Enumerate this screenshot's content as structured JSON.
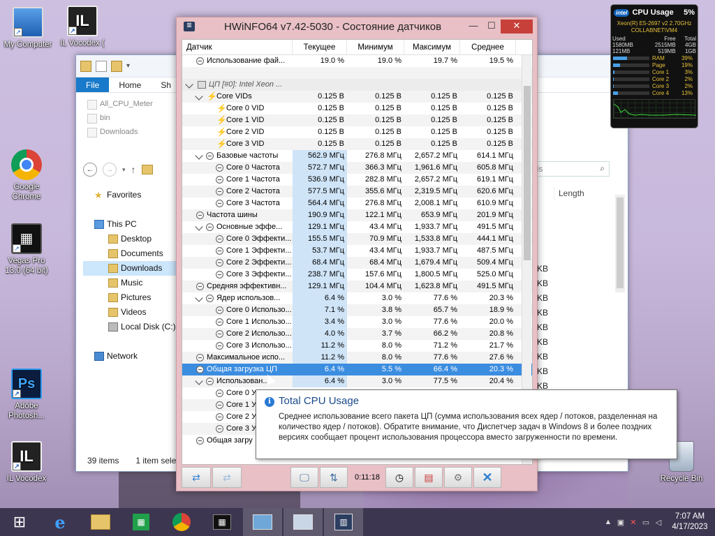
{
  "desktop": {
    "icons": [
      {
        "label": "My Computer",
        "icon": "computer-icon"
      },
      {
        "label": "IL Vocodex (",
        "icon": "il-vocodex-icon"
      },
      {
        "label": "Google Chrome",
        "icon": "chrome-icon"
      },
      {
        "label": "Vegas Pro 13.0 (64 bit)",
        "icon": "vegas-icon"
      },
      {
        "label": "Adobe Photosh...",
        "icon": "photoshop-icon"
      },
      {
        "label": "IL Vocodex",
        "icon": "il-vocodex-icon"
      },
      {
        "label": "Recycle Bin",
        "icon": "recycle-bin-icon"
      }
    ]
  },
  "explorer": {
    "ribbon": {
      "file": "File",
      "home": "Home",
      "share": "Sh"
    },
    "recent": [
      "All_CPU_Meter",
      "bin",
      "Downloads"
    ],
    "search_partial": "ads",
    "column_length": "Length",
    "nav": {
      "favorites": "Favorites",
      "this_pc": "This PC",
      "items": [
        "Desktop",
        "Documents",
        "Downloads",
        "Music",
        "Pictures",
        "Videos",
        "Local Disk (C:)"
      ],
      "network": "Network"
    },
    "kb_values": [
      "KB",
      "KB",
      "KB",
      "KB",
      "KB",
      "KB",
      "KB",
      "KB",
      "KB",
      "KB",
      "KB"
    ],
    "status_items": "39 items",
    "status_selected": "1 item selec"
  },
  "gadget": {
    "title": "CPU Usage",
    "percent": "5%",
    "cpu_line1": "Xeon(R) E5-2697 v2 2.70GHz",
    "cpu_line2": "COLLABNET\\VM4",
    "headers": [
      "Used",
      "Free",
      "Total"
    ],
    "row1": [
      "1580MB",
      "2515MB",
      "4GB"
    ],
    "row2": [
      "121MB",
      "519MB",
      "1GB"
    ],
    "meters": [
      {
        "label": "RAM",
        "value": "39%",
        "fill": 0.39
      },
      {
        "label": "Page",
        "value": "19%",
        "fill": 0.19
      },
      {
        "label": "Core 1",
        "value": "3%",
        "fill": 0.03
      },
      {
        "label": "Core 2",
        "value": "2%",
        "fill": 0.02
      },
      {
        "label": "Core 3",
        "value": "2%",
        "fill": 0.02
      },
      {
        "label": "Core 4",
        "value": "13%",
        "fill": 0.13
      }
    ]
  },
  "hwinfo": {
    "title": "HWiNFO64 v7.42-5030 - Состояние датчиков",
    "headers": {
      "sensor": "Датчик",
      "current": "Текущее",
      "min": "Минимум",
      "max": "Максимум",
      "avg": "Среднее"
    },
    "rows": [
      {
        "type": "circ",
        "indent": 0,
        "name": "Использование фай...",
        "cur": "19.0 %",
        "min": "19.0 %",
        "max": "19.7 %",
        "avg": "19.5 %"
      },
      {
        "type": "blank",
        "indent": 0,
        "name": "",
        "cur": "",
        "min": "",
        "max": "",
        "avg": ""
      },
      {
        "type": "grp",
        "indent": 0,
        "name": "ЦП [#0]: Intel Xeon ...",
        "cur": "",
        "min": "",
        "max": "",
        "avg": ""
      },
      {
        "type": "bolt",
        "indent": 1,
        "exp": true,
        "name": "Core VIDs",
        "cur": "0.125 В",
        "min": "0.125 В",
        "max": "0.125 В",
        "avg": "0.125 В"
      },
      {
        "type": "bolt",
        "indent": 2,
        "name": "Core 0 VID",
        "cur": "0.125 В",
        "min": "0.125 В",
        "max": "0.125 В",
        "avg": "0.125 В"
      },
      {
        "type": "bolt",
        "indent": 2,
        "name": "Core 1 VID",
        "cur": "0.125 В",
        "min": "0.125 В",
        "max": "0.125 В",
        "avg": "0.125 В"
      },
      {
        "type": "bolt",
        "indent": 2,
        "name": "Core 2 VID",
        "cur": "0.125 В",
        "min": "0.125 В",
        "max": "0.125 В",
        "avg": "0.125 В"
      },
      {
        "type": "bolt",
        "indent": 2,
        "name": "Core 3 VID",
        "cur": "0.125 В",
        "min": "0.125 В",
        "max": "0.125 В",
        "avg": "0.125 В"
      },
      {
        "type": "circ",
        "indent": 1,
        "exp": true,
        "hl": true,
        "name": "Базовые частоты",
        "cur": "562.9 МГц",
        "min": "276.8 МГц",
        "max": "2,657.2 МГц",
        "avg": "614.1 МГц"
      },
      {
        "type": "circ",
        "indent": 2,
        "hl": true,
        "name": "Core 0 Частота",
        "cur": "572.7 МГц",
        "min": "366.3 МГц",
        "max": "1,961.6 МГц",
        "avg": "605.8 МГц"
      },
      {
        "type": "circ",
        "indent": 2,
        "hl": true,
        "name": "Core 1 Частота",
        "cur": "536.9 МГц",
        "min": "282.8 МГц",
        "max": "2,657.2 МГц",
        "avg": "619.1 МГц"
      },
      {
        "type": "circ",
        "indent": 2,
        "hl": true,
        "name": "Core 2 Частота",
        "cur": "577.5 МГц",
        "min": "355.6 МГц",
        "max": "2,319.5 МГц",
        "avg": "620.6 МГц"
      },
      {
        "type": "circ",
        "indent": 2,
        "hl": true,
        "name": "Core 3 Частота",
        "cur": "564.4 МГц",
        "min": "276.8 МГц",
        "max": "2,008.1 МГц",
        "avg": "610.9 МГц"
      },
      {
        "type": "circ",
        "indent": 0,
        "hl": true,
        "name": "Частота шины",
        "cur": "190.9 МГц",
        "min": "122.1 МГц",
        "max": "653.9 МГц",
        "avg": "201.9 МГц"
      },
      {
        "type": "circ",
        "indent": 1,
        "exp": true,
        "hl": true,
        "name": "Основные эффе...",
        "cur": "129.1 МГц",
        "min": "43.4 МГц",
        "max": "1,933.7 МГц",
        "avg": "491.5 МГц"
      },
      {
        "type": "circ",
        "indent": 2,
        "hl": true,
        "name": "Core 0 Эффекти...",
        "cur": "155.5 МГц",
        "min": "70.9 МГц",
        "max": "1,533.8 МГц",
        "avg": "444.1 МГц"
      },
      {
        "type": "circ",
        "indent": 2,
        "hl": true,
        "name": "Core 1 Эффекти...",
        "cur": "53.7 МГц",
        "min": "43.4 МГц",
        "max": "1,933.7 МГц",
        "avg": "487.5 МГц"
      },
      {
        "type": "circ",
        "indent": 2,
        "hl": true,
        "name": "Core 2 Эффекти...",
        "cur": "68.4 МГц",
        "min": "68.4 МГц",
        "max": "1,679.4 МГц",
        "avg": "509.4 МГц"
      },
      {
        "type": "circ",
        "indent": 2,
        "hl": true,
        "name": "Core 3 Эффекти...",
        "cur": "238.7 МГц",
        "min": "157.6 МГц",
        "max": "1,800.5 МГц",
        "avg": "525.0 МГц"
      },
      {
        "type": "circ",
        "indent": 0,
        "hl": true,
        "name": "Средняя эффективн...",
        "cur": "129.1 МГц",
        "min": "104.4 МГц",
        "max": "1,623.8 МГц",
        "avg": "491.5 МГц"
      },
      {
        "type": "circ",
        "indent": 1,
        "exp": true,
        "hl": true,
        "name": "Ядер использов...",
        "cur": "6.4 %",
        "min": "3.0 %",
        "max": "77.6 %",
        "avg": "20.3 %"
      },
      {
        "type": "circ",
        "indent": 2,
        "hl": true,
        "name": "Core 0 Использо...",
        "cur": "7.1 %",
        "min": "3.8 %",
        "max": "65.7 %",
        "avg": "18.9 %"
      },
      {
        "type": "circ",
        "indent": 2,
        "hl": true,
        "name": "Core 1 Использо...",
        "cur": "3.4 %",
        "min": "3.0 %",
        "max": "77.6 %",
        "avg": "20.0 %"
      },
      {
        "type": "circ",
        "indent": 2,
        "hl": true,
        "name": "Core 2 Использо...",
        "cur": "4.0 %",
        "min": "3.7 %",
        "max": "66.2 %",
        "avg": "20.8 %"
      },
      {
        "type": "circ",
        "indent": 2,
        "hl": true,
        "name": "Core 3 Использо...",
        "cur": "11.2 %",
        "min": "8.0 %",
        "max": "71.2 %",
        "avg": "21.7 %"
      },
      {
        "type": "circ",
        "indent": 0,
        "hl": true,
        "name": "Максимальное испо...",
        "cur": "11.2 %",
        "min": "8.0 %",
        "max": "77.6 %",
        "avg": "27.6 %"
      },
      {
        "type": "circ",
        "indent": 0,
        "hl": true,
        "sel": true,
        "name": "Общая загрузка ЦП",
        "cur": "6.4 %",
        "min": "5.5 %",
        "max": "66.4 %",
        "avg": "20.3 %"
      },
      {
        "type": "circ",
        "indent": 1,
        "exp": true,
        "hl": true,
        "name": "Использован...",
        "cur": "6.4 %",
        "min": "3.0 %",
        "max": "77.5 %",
        "avg": "20.4 %"
      },
      {
        "type": "circ",
        "indent": 2,
        "name": "Core 0 Ут",
        "cur": "",
        "min": "",
        "max": "",
        "avg": ""
      },
      {
        "type": "circ",
        "indent": 2,
        "name": "Core 1 Ут",
        "cur": "",
        "min": "",
        "max": "",
        "avg": ""
      },
      {
        "type": "circ",
        "indent": 2,
        "name": "Core 2 Ут",
        "cur": "",
        "min": "",
        "max": "",
        "avg": ""
      },
      {
        "type": "circ",
        "indent": 2,
        "name": "Core 3 Ут",
        "cur": "",
        "min": "",
        "max": "",
        "avg": ""
      },
      {
        "type": "circ",
        "indent": 0,
        "name": "Общая загру",
        "cur": "",
        "min": "",
        "max": "",
        "avg": ""
      }
    ],
    "timer": "0:11:18"
  },
  "tooltip": {
    "title": "Total CPU Usage",
    "body": "Среднее использование всего пакета ЦП (сумма использования всех ядер / потоков, разделенная на количество ядер / потоков). Обратите внимание, что Диспетчер задач в Windows 8 и более поздних версиях сообщает процент использования процессора вместо загруженности по времени."
  },
  "taskbar": {
    "time": "7:07 AM",
    "date": "4/17/2023"
  }
}
